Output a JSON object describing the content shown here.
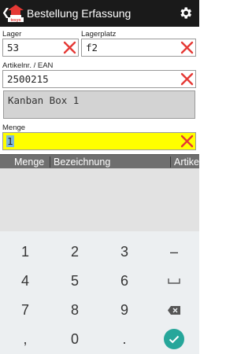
{
  "app": {
    "title": "Bestellung Erfassung"
  },
  "icons": {
    "back": "back-arrow-icon",
    "logo": "app-logo-icon",
    "settings": "gear-icon",
    "clear": "clear-x-icon",
    "backspace": "backspace-icon",
    "enter": "checkmark-icon"
  },
  "colors": {
    "clear_x": "#e53935",
    "highlight": "#ffff00",
    "enter_key": "#26a69a",
    "header_bg": "#6f6f6f"
  },
  "form": {
    "lager": {
      "label": "Lager",
      "value": "53"
    },
    "lagerplatz": {
      "label": "Lagerplatz",
      "value": "f2"
    },
    "artikel": {
      "label": "Artikelnr. / EAN",
      "value": "2500215"
    },
    "bezeichnung": {
      "value": "Kanban Box 1"
    },
    "menge": {
      "label": "Menge",
      "value": "1"
    }
  },
  "table": {
    "columns": [
      "Menge",
      "Bezeichnung",
      "Artike"
    ]
  },
  "keyboard": {
    "rows": [
      [
        "1",
        "2",
        "3",
        "–"
      ],
      [
        "4",
        "5",
        "6",
        "␣"
      ],
      [
        "7",
        "8",
        "9",
        "⌫"
      ],
      [
        ",",
        "0",
        ".",
        "✓"
      ]
    ]
  }
}
